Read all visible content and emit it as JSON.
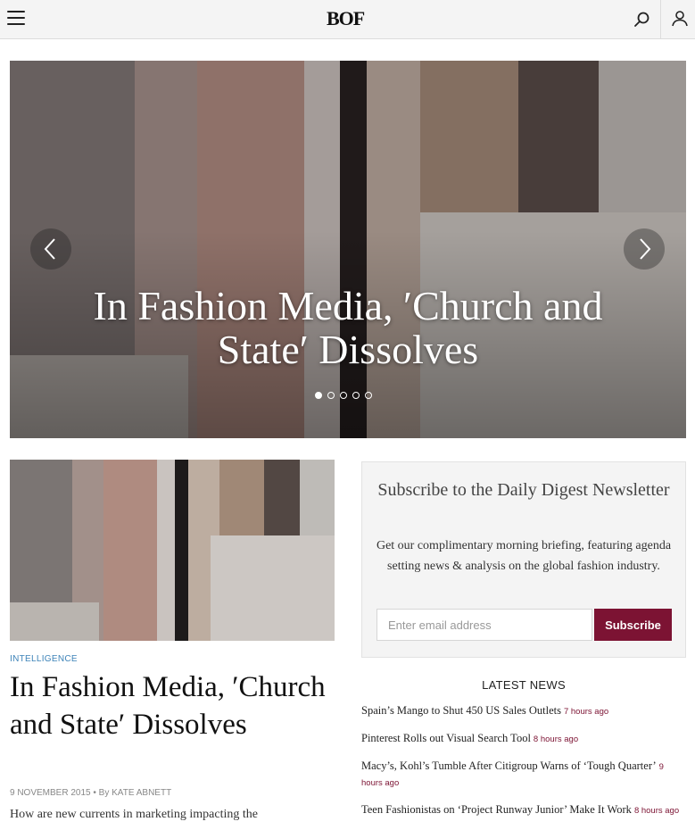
{
  "header": {
    "logo_text": "BOF",
    "menu_icon": "hamburger-menu-icon",
    "search_icon": "search-icon",
    "account_icon": "user-icon"
  },
  "hero": {
    "title": "In Fashion Media, ′Church and State′ Dissolves",
    "slide_count": 5,
    "active_slide": 1,
    "prev_icon": "chevron-left-icon",
    "next_icon": "chevron-right-icon"
  },
  "featured_article": {
    "category": "INTELLIGENCE",
    "title": "In Fashion Media, ′Church and State′ Dissolves",
    "date": "9 NOVEMBER 2015",
    "byline_sep": " • By ",
    "author": "KATE ABNETT",
    "excerpt": "How are new currents in marketing impacting the"
  },
  "newsletter": {
    "title": "Subscribe to the Daily Digest Newsletter",
    "description": "Get our complimentary morning briefing, featuring agenda setting news & analysis on the global fashion industry.",
    "email_placeholder": "Enter email address",
    "subscribe_label": "Subscribe",
    "accent_color": "#7c1333"
  },
  "latest_news": {
    "heading": "LATEST NEWS",
    "items": [
      {
        "headline": "Spain’s Mango to Shut 450 US Sales Outlets",
        "time": "7 hours ago"
      },
      {
        "headline": "Pinterest Rolls out Visual Search Tool",
        "time": "8 hours ago"
      },
      {
        "headline": "Macy’s, Kohl’s Tumble After Citigroup Warns of ‘Tough Quarter’",
        "time": "9 hours ago"
      },
      {
        "headline": "Teen Fashionistas on ‘Project Runway Junior’ Make It Work",
        "time": "8 hours ago"
      }
    ]
  }
}
